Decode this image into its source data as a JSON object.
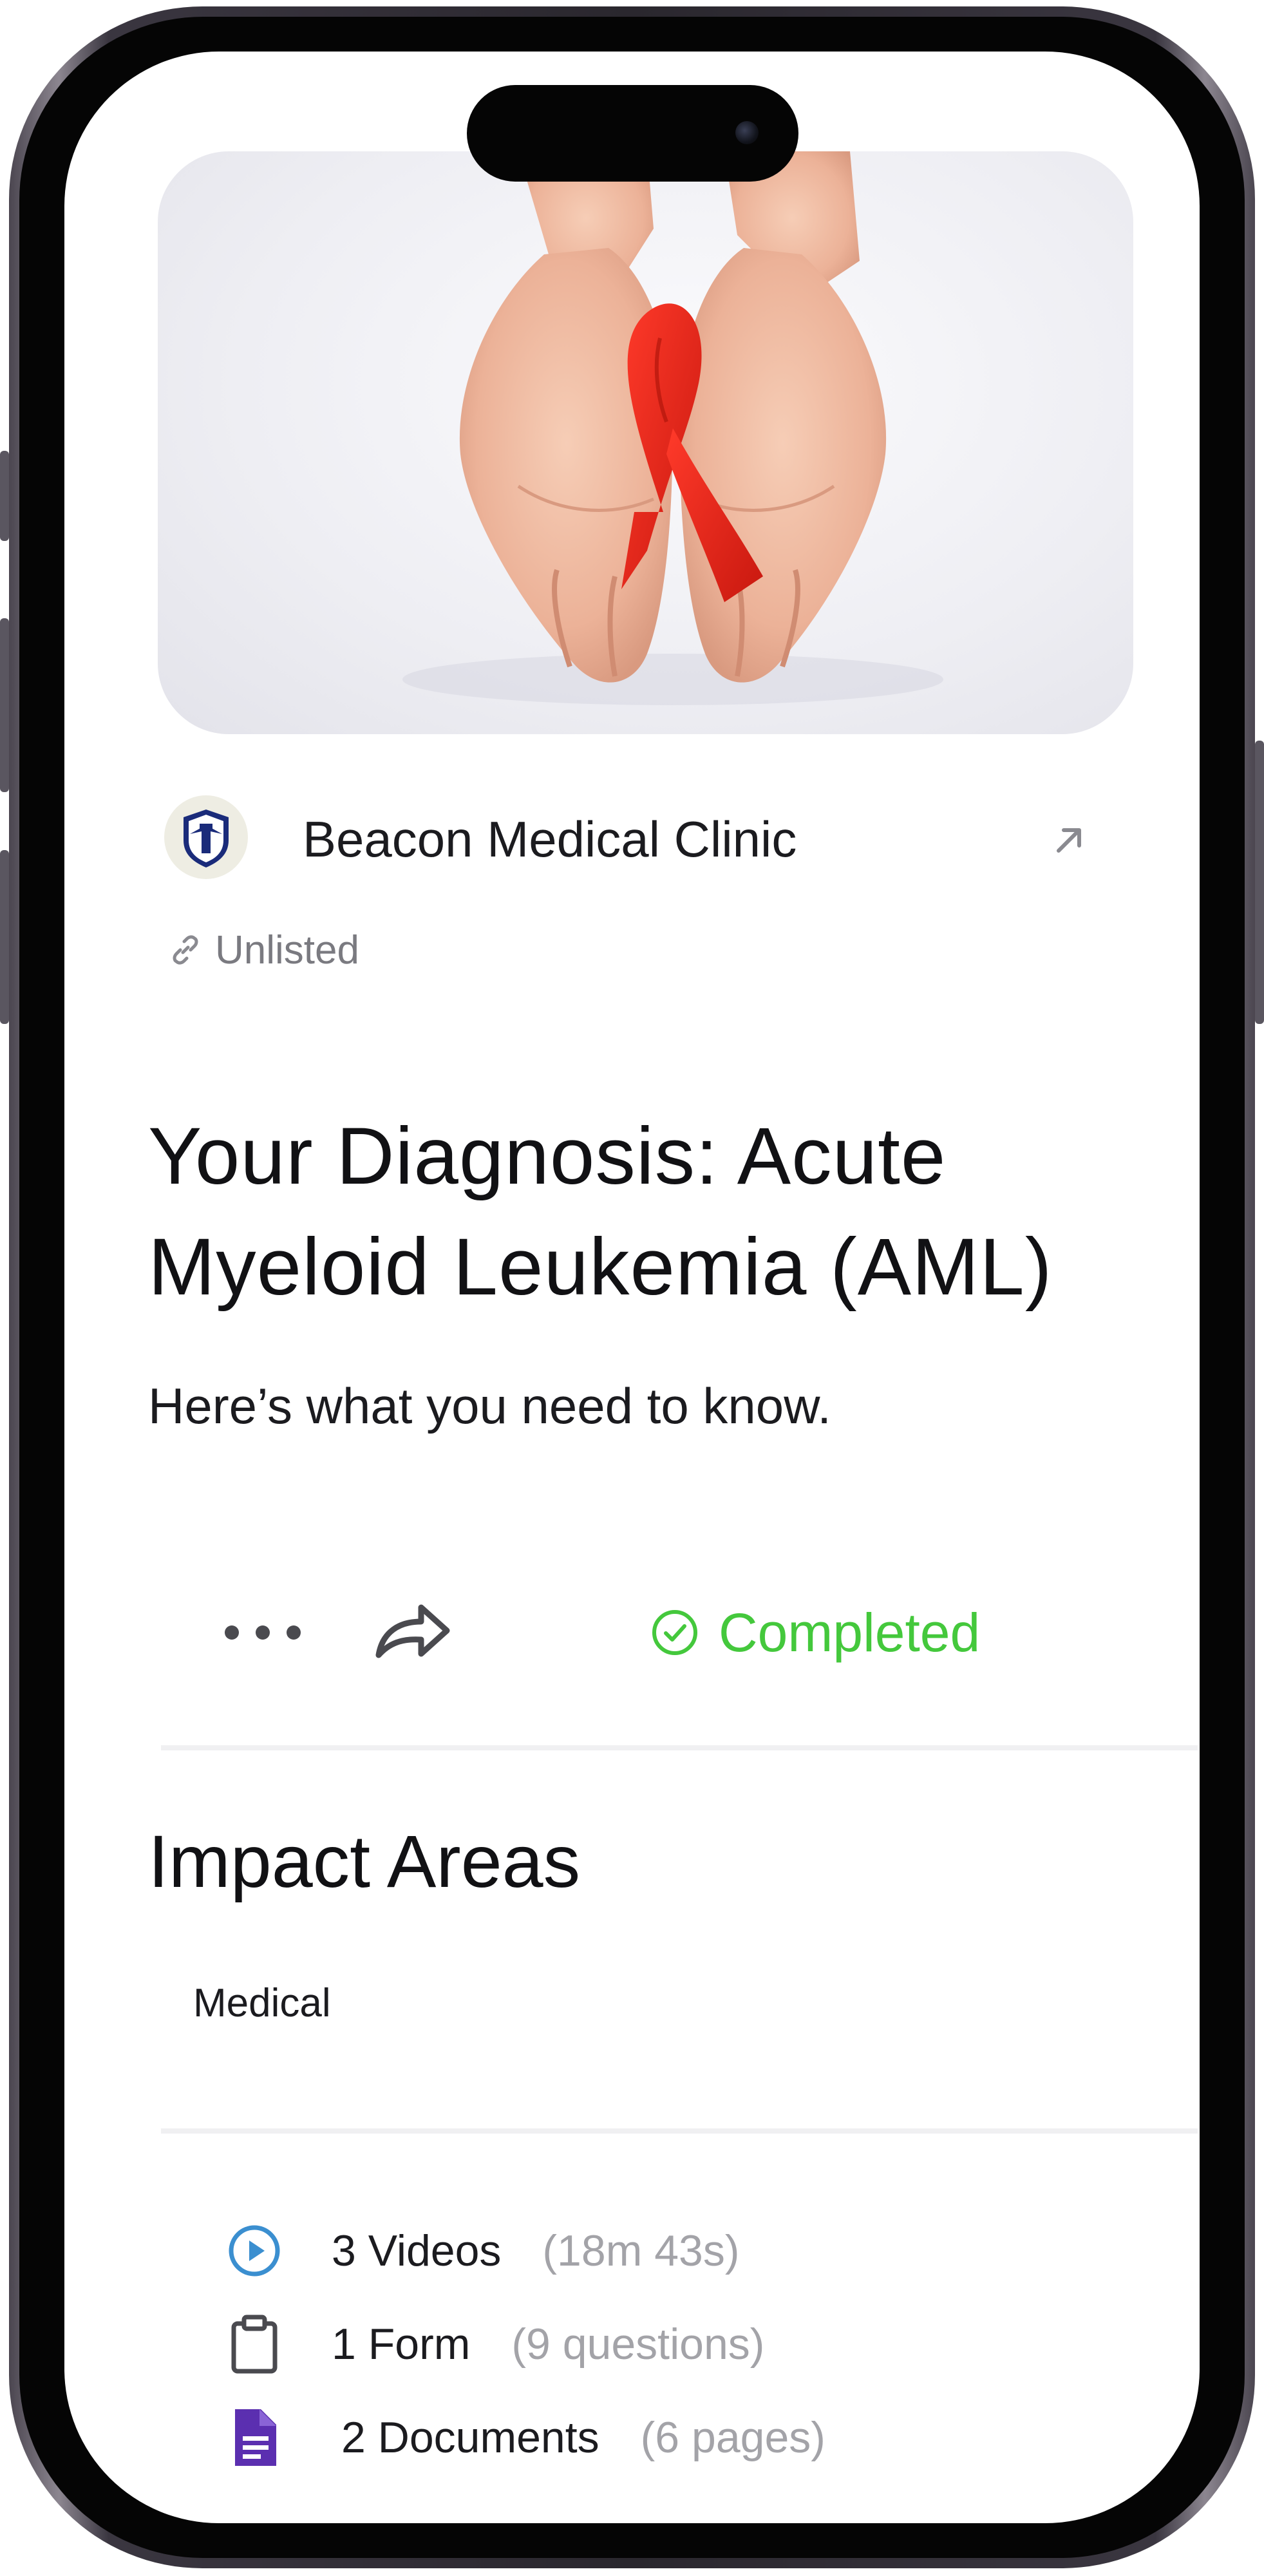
{
  "clinic": {
    "name": "Beacon Medical Clinic",
    "visibility": "Unlisted"
  },
  "content": {
    "title": "Your Diagnosis: Acute Myeloid Leukemia (AML)",
    "subtitle": "Here’s what you need to know."
  },
  "actions": {
    "status": "Completed",
    "status_color": "#44c83c"
  },
  "impact": {
    "heading": "Impact Areas",
    "tags": [
      "Medical"
    ]
  },
  "stats": [
    {
      "icon": "play-circle-icon",
      "count": "3 Videos",
      "detail": "(18m 43s)",
      "color": "#3b8fd0"
    },
    {
      "icon": "clipboard-icon",
      "count": "1 Form",
      "detail": "(9 questions)",
      "color": "#4a4a4f"
    },
    {
      "icon": "document-icon",
      "count": "2 Documents",
      "detail": "(6 pages)",
      "color": "#5b2fb0"
    }
  ]
}
